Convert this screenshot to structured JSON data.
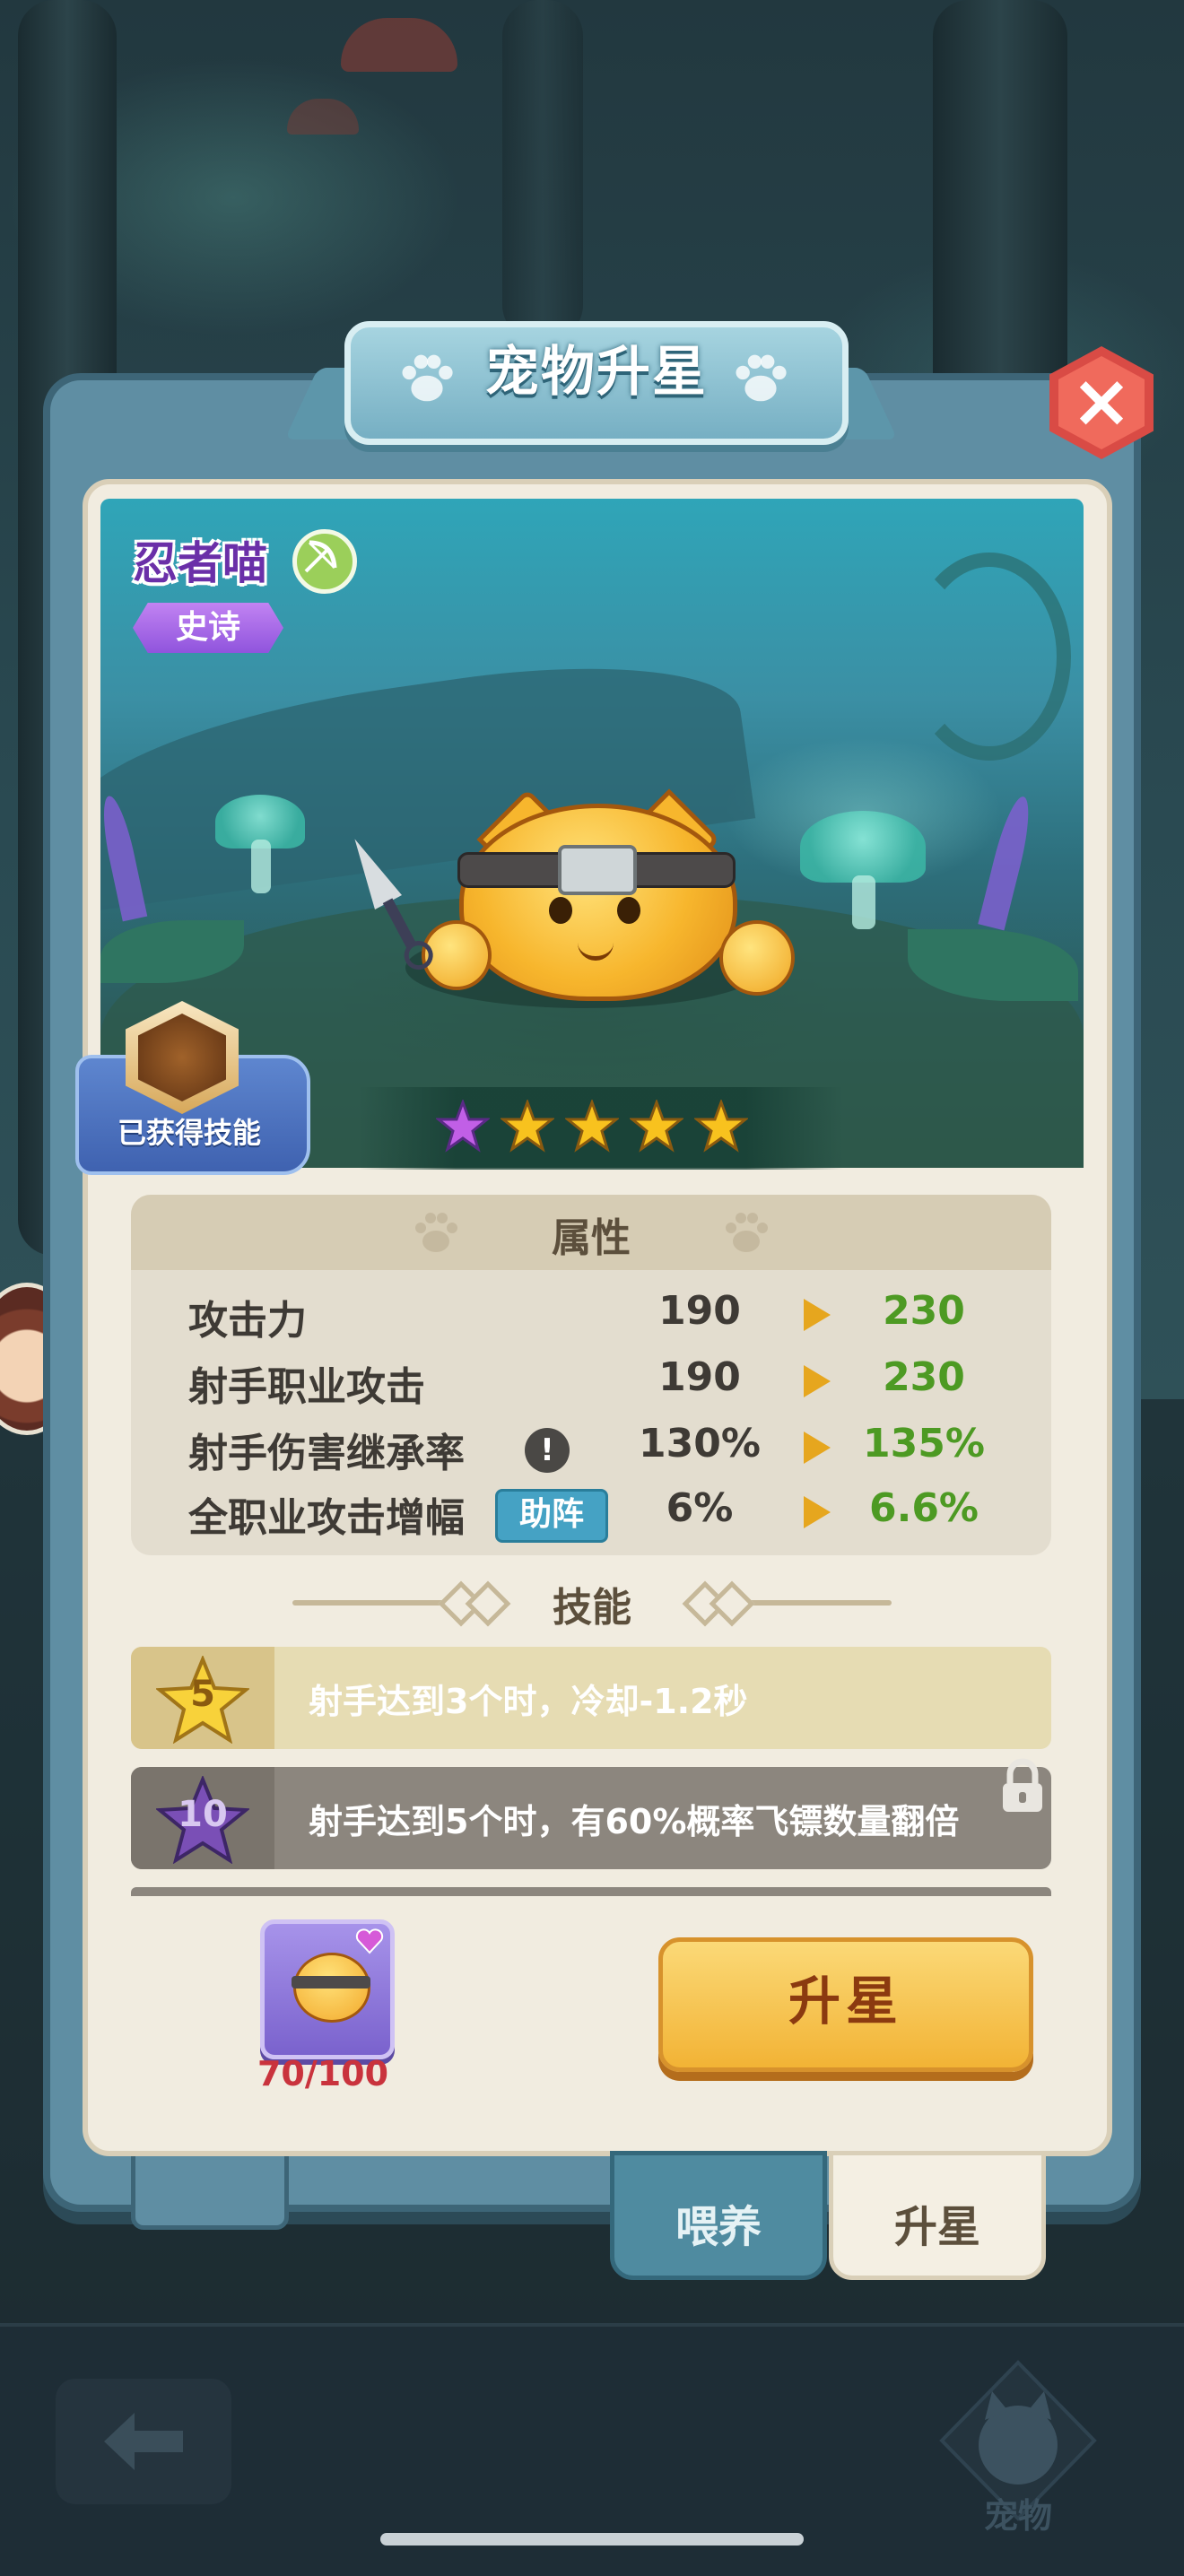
{
  "dialog": {
    "title": "宠物升星",
    "close_icon": "close-icon"
  },
  "pet": {
    "name": "忍者喵",
    "class_icon": "archer-class-icon",
    "rarity": "史诗",
    "skill_owned_label": "已获得技能",
    "stars": [
      {
        "color": "#c15fe6",
        "type": "purple"
      },
      {
        "color": "#f8c21e",
        "type": "gold"
      },
      {
        "color": "#f8c21e",
        "type": "gold"
      },
      {
        "color": "#f8c21e",
        "type": "gold"
      },
      {
        "color": "#f8c21e",
        "type": "gold"
      }
    ]
  },
  "attributes": {
    "title": "属性",
    "rows": [
      {
        "label": "攻击力",
        "current": "190",
        "next": "230"
      },
      {
        "label": "射手职业攻击",
        "current": "190",
        "next": "230"
      },
      {
        "label": "射手伤害继承率",
        "current": "130%",
        "next": "135%",
        "info": "!"
      },
      {
        "label": "全职业攻击增幅",
        "current": "6%",
        "next": "6.6%",
        "badge": "助阵"
      }
    ]
  },
  "skills": {
    "title": "技能",
    "rows": [
      {
        "level": "5",
        "text": "射手达到3个时，冷却-1.2秒",
        "locked": false
      },
      {
        "level": "10",
        "text": "射手达到5个时，有60%概率飞镖数量翻倍",
        "locked": true
      }
    ]
  },
  "upgrade": {
    "item_count": "70/100",
    "button_label": "升星"
  },
  "tabs": {
    "feed": "喂养",
    "star_up": "升星"
  },
  "bottom_nav": {
    "back_icon": "back-arrow-icon",
    "pet_label": "宠物"
  },
  "colors": {
    "accent_gold": "#f2b335",
    "stat_up_green": "#4d9a23",
    "title_blue": "#76afc3"
  }
}
